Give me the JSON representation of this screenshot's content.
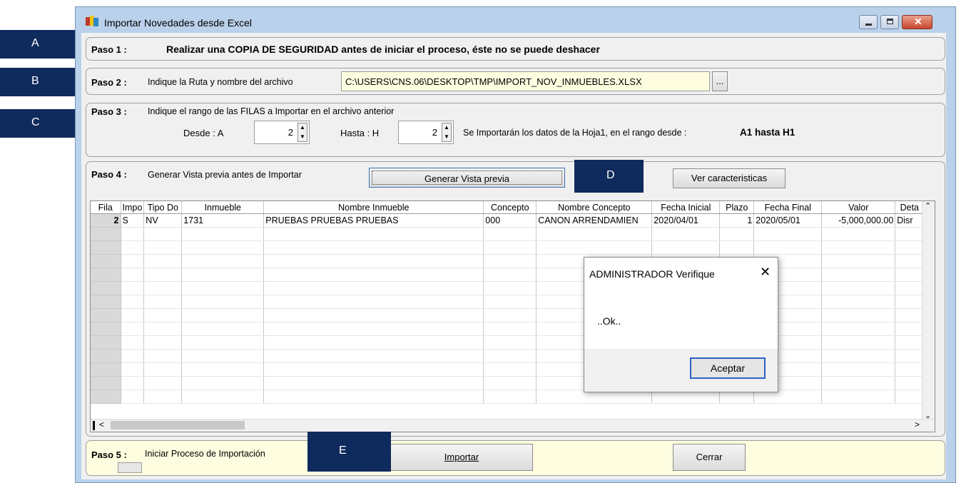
{
  "window": {
    "title": "Importar Novedades desde Excel",
    "controls": [
      "minimize-icon",
      "maximize-icon",
      "close-icon"
    ]
  },
  "paso1": {
    "label": "Paso 1 :",
    "text": "Realizar una COPIA DE SEGURIDAD antes de iniciar el proceso, éste no se puede deshacer"
  },
  "paso2": {
    "label": "Paso 2 :",
    "text": "Indique la Ruta y nombre del archivo",
    "path_value": "C:\\USERS\\CNS.06\\DESKTOP\\TMP\\IMPORT_NOV_INMUEBLES.XLSX",
    "browse_label": "..."
  },
  "paso3": {
    "label": "Paso 3 :",
    "text": "Indique el rango de las FILAS a Importar en el archivo anterior",
    "desde_label": "Desde :  A",
    "desde_value": "2",
    "hasta_label": "Hasta :  H",
    "hasta_value": "2",
    "info": "Se Importarán los datos de la Hoja1,  en el rango desde :",
    "range": "A1 hasta H1"
  },
  "paso4": {
    "label": "Paso 4 :",
    "text": "Generar Vista previa antes de Importar",
    "preview_button": "Generar Vista previa",
    "features_button": "Ver caracteristicas"
  },
  "grid": {
    "columns": [
      "Fila",
      "Impo",
      "Tipo Do",
      "Inmueble",
      "Nombre Inmueble",
      "Concepto",
      "Nombre Concepto",
      "Fecha Inicial",
      "Plazo",
      "Fecha Final",
      "Valor",
      "Deta"
    ],
    "row": {
      "fila": "2",
      "impo": "S",
      "tipo": "NV",
      "inmueble": "1731",
      "nombre_inmueble": "PRUEBAS PRUEBAS PRUEBAS",
      "concepto": "000",
      "nombre_concepto": "CANON ARRENDAMIEN",
      "fecha_inicial": "2020/04/01",
      "plazo": "1",
      "fecha_final": "2020/05/01",
      "valor": "-5,000,000.00",
      "deta": "Disr"
    }
  },
  "paso5": {
    "label": "Paso 5 :",
    "text": "Iniciar Proceso de Importación",
    "importar_button": "Importar",
    "cerrar_button": "Cerrar"
  },
  "dialog": {
    "title": "ADMINISTRADOR Verifique",
    "message": "..Ok..",
    "ok_button": "Aceptar"
  },
  "annotations": {
    "a": "A",
    "b": "B",
    "c": "C",
    "d": "D",
    "e": "E",
    "color": "#0f2a5c"
  }
}
